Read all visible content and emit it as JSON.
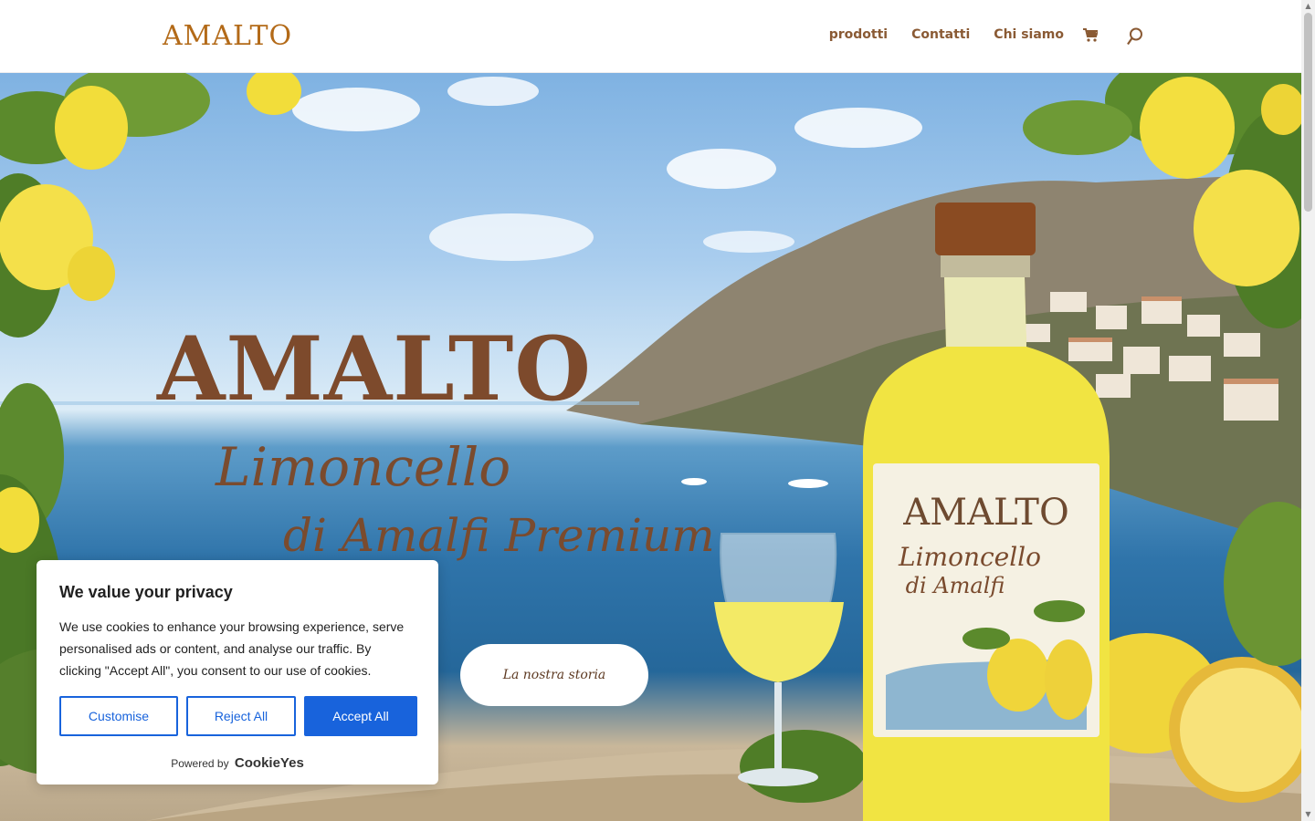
{
  "header": {
    "logo": "AMALTO",
    "nav": [
      "prodotti",
      "Contatti",
      "Chi siamo"
    ],
    "icons": [
      "cart-icon",
      "search-icon"
    ]
  },
  "hero": {
    "title": "AMALTO",
    "subtitle_line1": "Limoncello",
    "subtitle_line2": "di Amalfi Premium",
    "cta": "La nostra storia",
    "bottle_label_brand": "AMALTO",
    "bottle_label_line1": "Limoncello",
    "bottle_label_line2": "di Amalfi"
  },
  "cookie_banner": {
    "title": "We value your privacy",
    "text": "We use cookies to enhance your browsing experience, serve personalised ads or content, and analyse our traffic. By clicking \"Accept All\", you consent to our use of cookies.",
    "customise": "Customise",
    "reject": "Reject All",
    "accept": "Accept All",
    "powered_by": "Powered by",
    "brand": "CookieYes"
  },
  "colors": {
    "brand_gold": "#b36a18",
    "nav_brown": "#8a5a34",
    "hero_brown": "#7d4a2c",
    "cookie_blue": "#1863dc"
  }
}
